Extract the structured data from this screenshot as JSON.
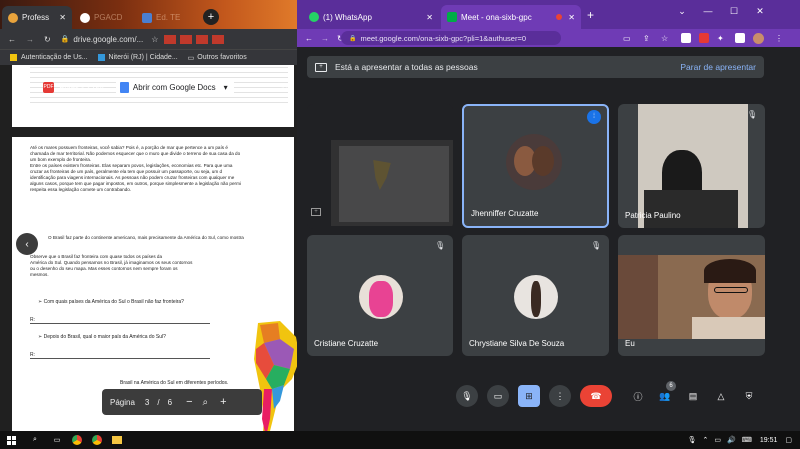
{
  "left_window": {
    "tabs": [
      {
        "label": "Profess",
        "close": "✕"
      },
      {
        "label": "PGACD",
        "close": ""
      },
      {
        "label": "Ed. TE",
        "close": ""
      }
    ],
    "url": "drive.google.com/...",
    "bookmarks": [
      "Autenticação de Us...",
      "Niterói (RJ) | Cidade...",
      "Outros favoritos"
    ],
    "pdf_title": "Aulas - 2.pdf",
    "open_with_label": "Abrir com Google Docs",
    "page_text": [
      "Até os mares possuem fronteiras, você sabia? Pois é, a porção de mar que pertence a um país é",
      "chamada de mar territorial. Não podemos esquecer que o muro que divide o terreno de sua casa da do",
      "um bom exemplo de fronteira.",
      "Entre os países existem fronteiras. Elas separam povos, legislações, economias etc. Para que uma",
      "cruzar as fronteiras de um país, geralmente ela tem que possuir um passaporte, ou seja, um d",
      "identificação para viagens internacionais. As pessoas não podem cruzar fronteiras com qualquer me",
      "alguns casos, porque tem que pagar impostos, em outros, porque simplesmente a legislação não permi",
      "respeita essa legislação comete um contrabando."
    ],
    "page_text2": "O Brasil faz parte do continente americano, mais precisamente da América do Sul, como mostra",
    "page_text3": [
      "Observe que o Brasil faz fronteira com quase todos os países da",
      "América do Sul. Quando pensamos no Brasil, já imaginamos os seus contornos",
      "ou o desenho do seu mapa. Mas esses contornos nem sempre foram os",
      "mesmos."
    ],
    "question1": "Com quais países da América do Sul o Brasil não faz fronteira?",
    "question2": "Depois do Brasil, qual o maior país da América do Sul?",
    "answer_label": "R:",
    "caption": "Brasil na América do Sul em diferentes períodos.",
    "pager": {
      "label": "Página",
      "current": "3",
      "sep": "/",
      "total": "6"
    }
  },
  "right_window": {
    "tabs": [
      {
        "label": "(1) WhatsApp"
      },
      {
        "label": "Meet - ona-sixb-gpc"
      }
    ],
    "url": "meet.google.com/ona-sixb-gpc?pli=1&authuser=0",
    "presenting_text": "Está a apresentar a todas as pessoas",
    "stop_presenting": "Parar de apresentar",
    "participants": [
      {
        "name": "Jhenniffer Cruzatte",
        "speaking": true,
        "muted": false
      },
      {
        "name": "Patricia Paulino",
        "speaking": false,
        "muted": true
      },
      {
        "name": "Cristiane Cruzatte",
        "speaking": false,
        "muted": true
      },
      {
        "name": "Chrystiane Silva De Souza",
        "speaking": false,
        "muted": true
      },
      {
        "name": "Eu",
        "speaking": false,
        "muted": false
      }
    ],
    "people_count": "6"
  },
  "taskbar": {
    "time": "19:51"
  }
}
